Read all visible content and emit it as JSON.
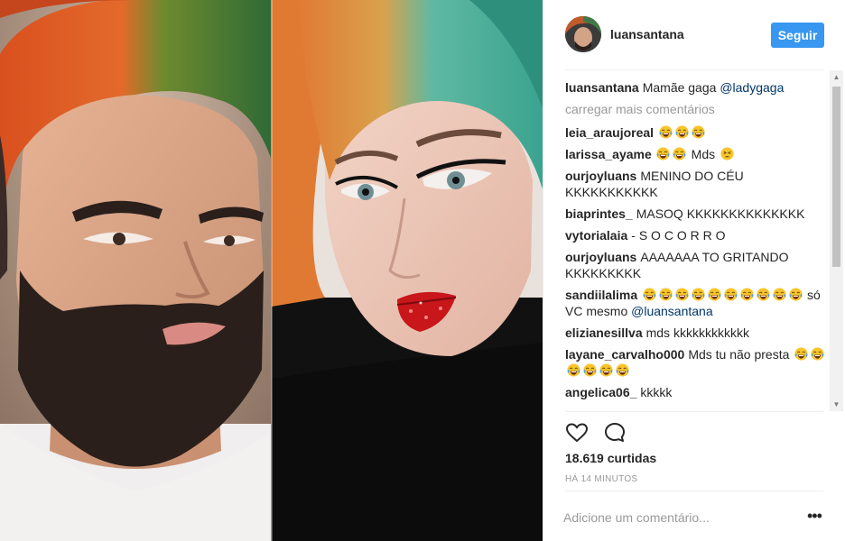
{
  "post": {
    "author": "luansantana",
    "follow_label": "Seguir",
    "caption_user": "luansantana",
    "caption_text": "Mamãe gaga",
    "caption_mention": "@ladygaga",
    "load_more_label": "carregar mais comentários",
    "likes_label": "18.619 curtidas",
    "timestamp_label": "HÁ 14 MINUTOS",
    "add_comment_placeholder": "Adicione um comentário...",
    "more_options_label": "•••"
  },
  "comments": [
    {
      "user": "leia_araujoreal",
      "text": "",
      "emojis": 3,
      "emojis_after": 0,
      "mention": "",
      "sad": false
    },
    {
      "user": "larissa_ayame",
      "text": "Mds",
      "emojis": 2,
      "emojis_after": 0,
      "mention": "",
      "sad": true
    },
    {
      "user": "ourjoyluans",
      "text": "MENINO DO CÉU KKKKKKKKKKK",
      "emojis": 0,
      "emojis_after": 0,
      "mention": "",
      "sad": false
    },
    {
      "user": "biaprintes_",
      "text": "MASOQ KKKKKKKKKKKKKK",
      "emojis": 0,
      "emojis_after": 0,
      "mention": "",
      "sad": false
    },
    {
      "user": "vytorialaia",
      "text": "- S O C O R R O",
      "emojis": 0,
      "emojis_after": 0,
      "mention": "",
      "sad": false
    },
    {
      "user": "ourjoyluans",
      "text": "AAAAAAA TO GRITANDO KKKKKKKKK",
      "emojis": 0,
      "emojis_after": 0,
      "mention": "",
      "sad": false
    },
    {
      "user": "sandiilalima",
      "text": "só VC mesmo",
      "emojis": 10,
      "emojis_after": 0,
      "mention": "@luansantana",
      "sad": false
    },
    {
      "user": "elizianesillva",
      "text": "mds kkkkkkkkkkkk",
      "emojis": 0,
      "emojis_after": 0,
      "mention": "",
      "sad": false
    },
    {
      "user": "layane_carvalho000",
      "text": "Mds tu não presta",
      "emojis": 0,
      "emojis_after": 6,
      "mention": "",
      "sad": false
    },
    {
      "user": "angelica06_",
      "text": "kkkkk",
      "emojis": 0,
      "emojis_after": 0,
      "mention": "",
      "sad": false
    }
  ],
  "icons": {
    "heart": "heart-icon",
    "comment": "comment-icon",
    "emoji": "tears-of-joy-emoji-icon",
    "sad_emoji": "persevering-face-emoji-icon"
  },
  "colors": {
    "follow_button": "#3897f0",
    "mention": "#003569",
    "muted": "#999999",
    "text": "#262626",
    "emoji_face": "#f7c52b"
  }
}
